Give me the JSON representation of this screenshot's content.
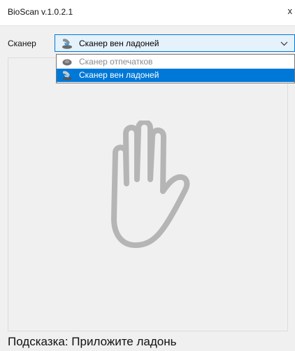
{
  "window": {
    "title": "BioScan v.1.0.2.1",
    "close_glyph": "x"
  },
  "scanner": {
    "label": "Сканер",
    "selected_value": "Сканер вен ладоней",
    "selected_icon": "palm-vein-scanner-icon",
    "options": [
      {
        "label": "Сканер отпечатков",
        "icon": "fingerprint-scanner-icon",
        "enabled": false
      },
      {
        "label": "Сканер вен ладоней",
        "icon": "palm-vein-scanner-icon",
        "enabled": true,
        "selected": true
      }
    ]
  },
  "scan_area": {
    "placeholder_icon": "hand-icon"
  },
  "hint": {
    "text": "Подсказка: Приложите ладонь"
  },
  "colors": {
    "accent": "#0078d7",
    "combo_background": "#e5f1fb",
    "window_background": "#f0f0f0",
    "hand_stroke": "#b5b5b5"
  }
}
